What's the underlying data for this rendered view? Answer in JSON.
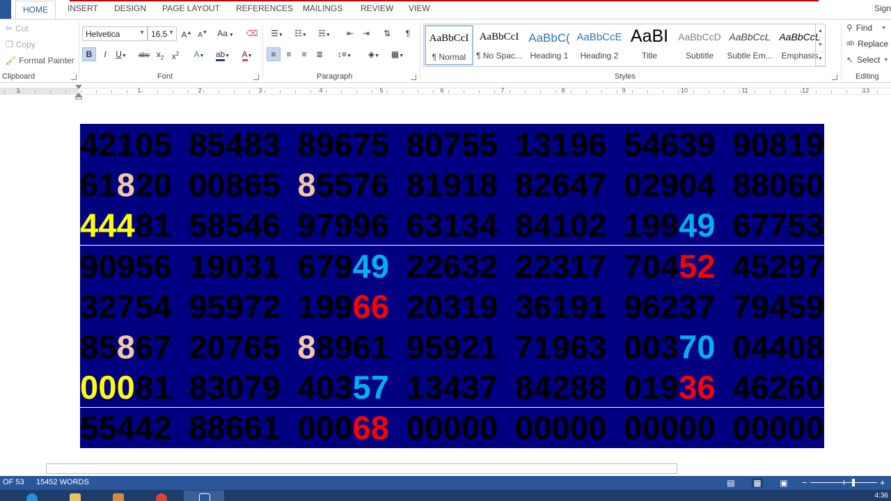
{
  "ribbon": {
    "tabs": [
      "HOME",
      "INSERT",
      "DESIGN",
      "PAGE LAYOUT",
      "REFERENCES",
      "MAILINGS",
      "REVIEW",
      "VIEW"
    ],
    "signin": "Sign",
    "clipboard": {
      "cut": "Cut",
      "copy": "Copy",
      "format_painter": "Format Painter",
      "label": "Clipboard"
    },
    "font": {
      "name": "Helvetica",
      "size": "16.5",
      "label": "Font",
      "case_label": "Aa"
    },
    "paragraph": {
      "label": "Paragraph"
    },
    "styles": {
      "label": "Styles",
      "items": [
        {
          "preview": "AaBbCcI",
          "name": "¶ Normal"
        },
        {
          "preview": "AaBbCcI",
          "name": "¶ No Spac..."
        },
        {
          "preview": "AaBbC(",
          "name": "Heading 1"
        },
        {
          "preview": "AaBbCcE",
          "name": "Heading 2"
        },
        {
          "preview": "AaBI",
          "name": "Title"
        },
        {
          "preview": "AaBbCcD",
          "name": "Subtitle"
        },
        {
          "preview": "AaBbCcL",
          "name": "Subtle Em..."
        },
        {
          "preview": "AaBbCcL",
          "name": "Emphasis"
        }
      ]
    },
    "editing": {
      "find": "Find",
      "replace": "Replace",
      "select": "Select",
      "label": "Editing"
    }
  },
  "ruler": {
    "numbers": [
      "1",
      "1",
      "2",
      "3",
      "4",
      "5",
      "6",
      "7",
      "8",
      "9",
      "10",
      "11",
      "12",
      "13"
    ]
  },
  "document": {
    "colors": {
      "background": "#000080",
      "digits": "#000000",
      "peach": "#f4c7a3",
      "yellow": "#ffff00",
      "blue": "#00b0f0",
      "red": "#ff0000"
    },
    "rows": [
      [
        "42105",
        "85483",
        "89675",
        "80755",
        "13196",
        "54639",
        "90819"
      ],
      [
        "61820",
        "00865",
        "85576",
        "81918",
        "82647",
        "02904",
        "88060"
      ],
      [
        "44481",
        "58546",
        "97996",
        "63134",
        "84102",
        "19949",
        "67753"
      ],
      [
        "90956",
        "19031",
        "67949",
        "22632",
        "22317",
        "70452",
        "45297"
      ],
      [
        "32754",
        "95972",
        "19966",
        "20319",
        "36191",
        "96237",
        "79459"
      ],
      [
        "85867",
        "20765",
        "88961",
        "95921",
        "71963",
        "00370",
        "04408"
      ],
      [
        "00081",
        "83079",
        "40357",
        "13437",
        "84288",
        "01936",
        "46260"
      ],
      [
        "55442",
        "88661",
        "00068",
        "00000",
        "00000",
        "00000",
        "00000"
      ]
    ],
    "highlights": [
      {
        "row": 1,
        "group": 0,
        "start": 2,
        "length": 1,
        "color": "peach"
      },
      {
        "row": 1,
        "group": 2,
        "start": 0,
        "length": 1,
        "color": "peach"
      },
      {
        "row": 2,
        "group": 0,
        "start": 0,
        "length": 3,
        "color": "yellow"
      },
      {
        "row": 2,
        "group": 5,
        "start": 3,
        "length": 2,
        "color": "blue"
      },
      {
        "row": 3,
        "group": 2,
        "start": 3,
        "length": 2,
        "color": "blue"
      },
      {
        "row": 3,
        "group": 5,
        "start": 3,
        "length": 2,
        "color": "red"
      },
      {
        "row": 4,
        "group": 2,
        "start": 3,
        "length": 2,
        "color": "red"
      },
      {
        "row": 5,
        "group": 0,
        "start": 2,
        "length": 1,
        "color": "peach"
      },
      {
        "row": 5,
        "group": 2,
        "start": 0,
        "length": 1,
        "color": "peach"
      },
      {
        "row": 5,
        "group": 5,
        "start": 3,
        "length": 2,
        "color": "blue"
      },
      {
        "row": 6,
        "group": 0,
        "start": 0,
        "length": 3,
        "color": "yellow"
      },
      {
        "row": 6,
        "group": 2,
        "start": 3,
        "length": 2,
        "color": "blue"
      },
      {
        "row": 6,
        "group": 5,
        "start": 3,
        "length": 2,
        "color": "red"
      },
      {
        "row": 7,
        "group": 2,
        "start": 3,
        "length": 2,
        "color": "red"
      }
    ]
  },
  "status": {
    "page": "OF 53",
    "words": "15452 WORDS"
  },
  "taskbar": {
    "clock": "4:36"
  }
}
